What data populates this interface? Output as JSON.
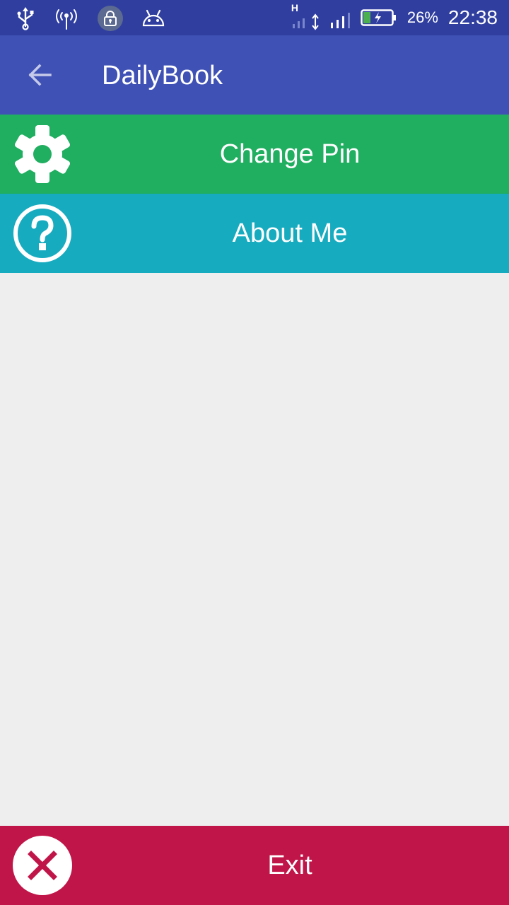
{
  "status_bar": {
    "left_icons": [
      "usb-icon",
      "hotspot-icon",
      "lock-icon",
      "android-icon"
    ],
    "right_icons": [
      "signal-h-icon",
      "data-arrows-icon",
      "signal-icon",
      "battery-charging-icon"
    ],
    "network_type": "H",
    "battery_percent": "26%",
    "time": "22:38",
    "battery_level": 0.26,
    "battery_color": "#4caf50"
  },
  "toolbar": {
    "title": "DailyBook",
    "back_icon": "arrow-back-icon",
    "background": "#3f51b5"
  },
  "menu": {
    "items": [
      {
        "label": "Change Pin",
        "icon": "gear-icon",
        "color": "#20ae60"
      },
      {
        "label": "About Me",
        "icon": "help-circle-icon",
        "color": "#17abc0"
      }
    ]
  },
  "footer": {
    "exit_label": "Exit",
    "exit_icon": "close-icon",
    "color": "#c01548"
  }
}
